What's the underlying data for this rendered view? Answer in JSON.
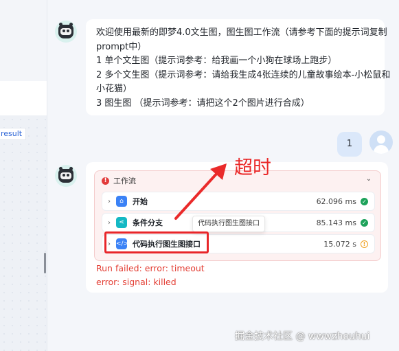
{
  "sidebar": {
    "result_tag": "result"
  },
  "bot_message": {
    "lines": [
      "欢迎使用最新的即梦4.0文生图，图生图工作流（请参考下面的提示词复制",
      "prompt中）",
      "1 单个文生图（提示词参考：给我画一个小狗在球场上跑步）",
      "2 多个文生图（提示词参考：请给我生成4张连续的儿童故事绘本-小松鼠和",
      "小花猫）",
      "3 图生图  （提示词参考：请把这个2个图片进行合成）"
    ]
  },
  "user_message": {
    "text": "1"
  },
  "workflow": {
    "title": "工作流",
    "nodes": [
      {
        "label": "开始",
        "time": "62.096 ms",
        "status": "success",
        "icon": "home-icon",
        "icon_color": "#3b82f6"
      },
      {
        "label": "条件分支",
        "time": "85.143 ms",
        "status": "success",
        "icon": "branch-icon",
        "icon_color": "#14b8c4"
      },
      {
        "label": "代码执行图生图接口",
        "time": "15.072 s",
        "status": "warning",
        "icon": "code-icon",
        "icon_color": "#3b82f6"
      }
    ],
    "tooltip": "代码执行图生图接口"
  },
  "errors": [
    "Run failed: error: timeout",
    "error: signal: killed"
  ],
  "annotation": {
    "label": "超时",
    "color": "#ea2a2a"
  },
  "watermark": "掘金技术社区 @ wwwzhouhui"
}
